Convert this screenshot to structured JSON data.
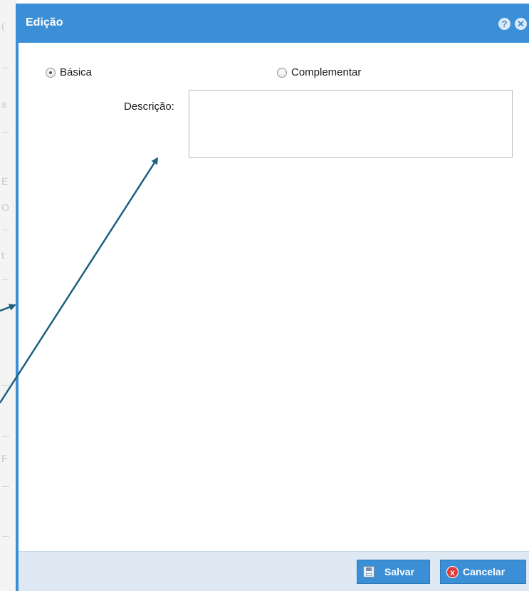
{
  "dialog": {
    "title": "Edição",
    "help_icon": "?",
    "close_icon": "✕"
  },
  "form": {
    "radio_basica": "Básica",
    "radio_complementar": "Complementar",
    "selected": "Básica",
    "descricao_label": "Descrição:",
    "descricao_value": ""
  },
  "footer": {
    "save_label": "Salvar",
    "cancel_label": "Cancelar",
    "cancel_icon": "x"
  },
  "colors": {
    "accent": "#3a8fd6",
    "annotation_arrow": "#1d5f80",
    "cancel_icon": "#e03a3a"
  }
}
